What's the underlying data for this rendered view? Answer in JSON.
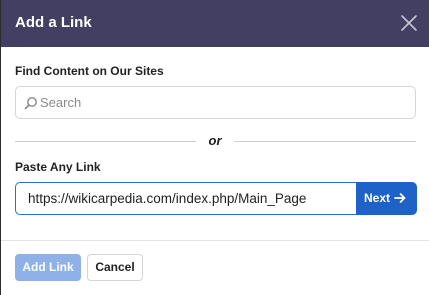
{
  "dialog": {
    "title": "Add a Link",
    "close_icon": "close-icon",
    "header_color": "#433f62"
  },
  "find_section": {
    "label": "Find Content on Our Sites",
    "search_placeholder": "Search",
    "search_value": "",
    "search_icon": "search-icon"
  },
  "divider": {
    "text": "or"
  },
  "paste_section": {
    "label": "Paste Any Link",
    "link_value": "https://wikicarpedia.com/index.php/Main_Page",
    "next_label": "Next",
    "next_icon": "arrow-right-icon",
    "accent_color": "#1f62c7"
  },
  "footer": {
    "add_label": "Add Link",
    "add_enabled": false,
    "cancel_label": "Cancel"
  }
}
